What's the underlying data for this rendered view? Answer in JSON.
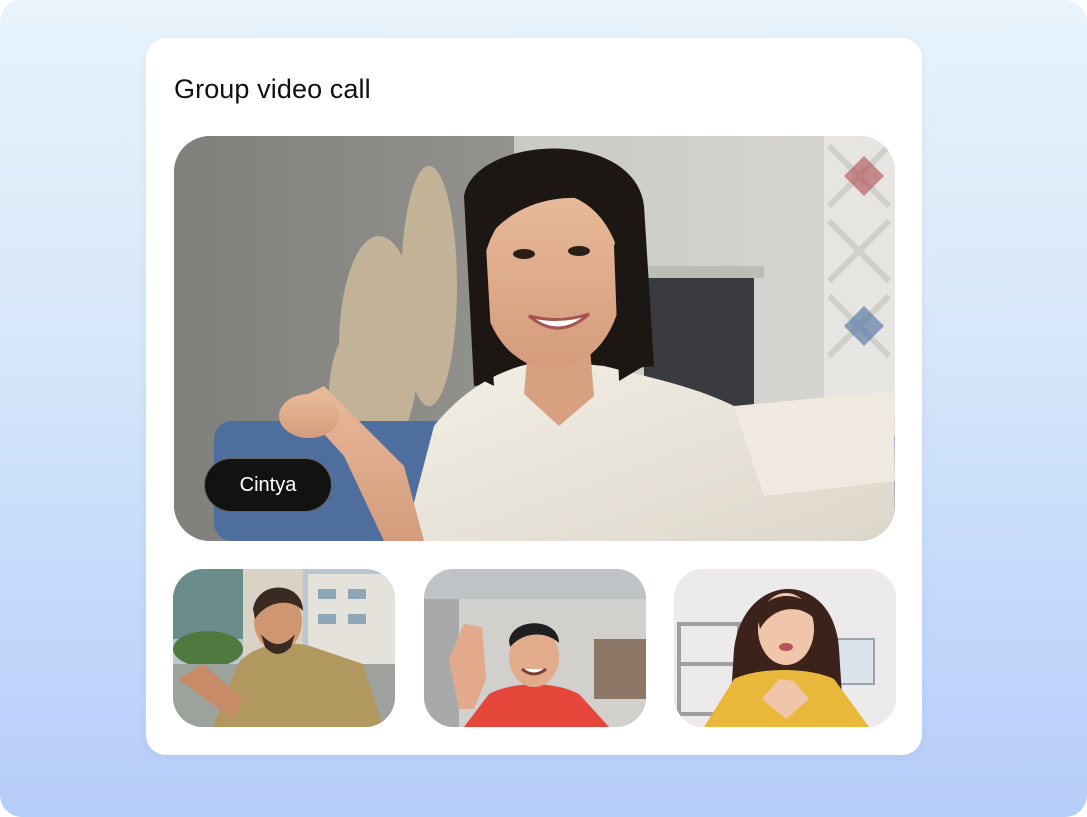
{
  "call": {
    "title": "Group video call",
    "active_speaker": {
      "name": "Cintya"
    },
    "participants": [
      {
        "label": "participant-man-green-shirt"
      },
      {
        "label": "participant-man-red-shirt"
      },
      {
        "label": "participant-woman-yellow-top"
      }
    ]
  },
  "colors": {
    "background_top": "#e8f3fb",
    "background_bottom": "#b6cdf8",
    "card": "#ffffff",
    "name_tag": "#121212"
  }
}
